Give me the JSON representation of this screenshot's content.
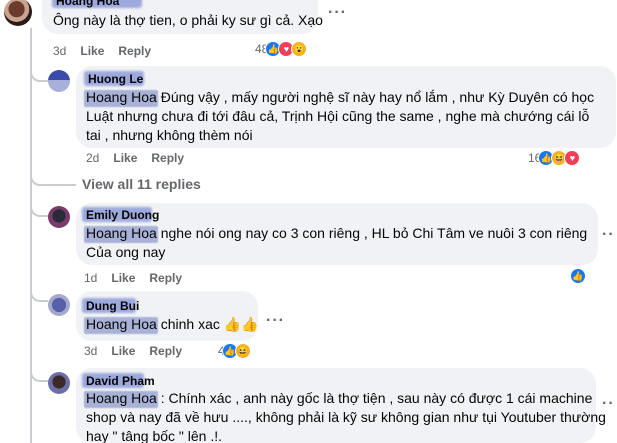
{
  "comments": [
    {
      "author": "Hoang Hoa",
      "text": "Ông này là thợ tien, o phải ky sư gì cả. Xạo",
      "time": "3d",
      "like": "Like",
      "reply": "Reply",
      "reaction_count": "48",
      "reactions": [
        "like-icon",
        "love-icon",
        "wow-icon"
      ]
    },
    {
      "author": "Huong Le",
      "tag": "Hoang Hoa",
      "text_line1": " Đúng vậy , mấy người nghệ sĩ này hay nổ lắm , như Kỳ Duyên có học",
      "text_line2": "Luật nhưng chưa đi tới đâu cả, Trịnh Hội cũng the same , nghe mà chướng cái lỗ",
      "text_line3": "tai , nhưng không thèm nói",
      "time": "2d",
      "like": "Like",
      "reply": "Reply",
      "reaction_count": "16",
      "reactions": [
        "like-icon",
        "haha-icon",
        "love-icon"
      ]
    },
    {
      "author": "Emily Duong",
      "tag": "Hoang Hoa",
      "text_line1": " nghe nói ong nay co 3 con riêng , HL bỏ Chi Tâm ve nuôi 3 con riêng",
      "text_line2": "Của ong nay",
      "time": "1d",
      "like": "Like",
      "reply": "Reply",
      "reactions": [
        "like-icon"
      ]
    },
    {
      "author": "Dung Bui",
      "tag": "Hoang Hoa",
      "text_line1": " chinh xac 👍👍",
      "time": "3d",
      "like": "Like",
      "reply": "Reply",
      "reaction_count": "4",
      "reactions": [
        "like-icon",
        "haha-icon"
      ]
    },
    {
      "author": "David Pham",
      "tag": "Hoang Hoa",
      "text_line1": " : Chính xác , anh này gốc là thợ tiện , sau này có được 1 cái machine",
      "text_line2": "shop và nay đã về hưu ...., không phải là kỹ sư không gian như tụi Youtuber thường",
      "text_line3": "hay \" tâng bốc \" lên .!."
    }
  ],
  "view_all": "View all 11 replies",
  "more_icon": "more-horizontal-icon",
  "colors": {
    "bubble": "#f0f2f5",
    "meta": "#65676b",
    "like_blue": "#1877f2",
    "love_red": "#f33e58",
    "haha_yellow": "#f7b125"
  }
}
